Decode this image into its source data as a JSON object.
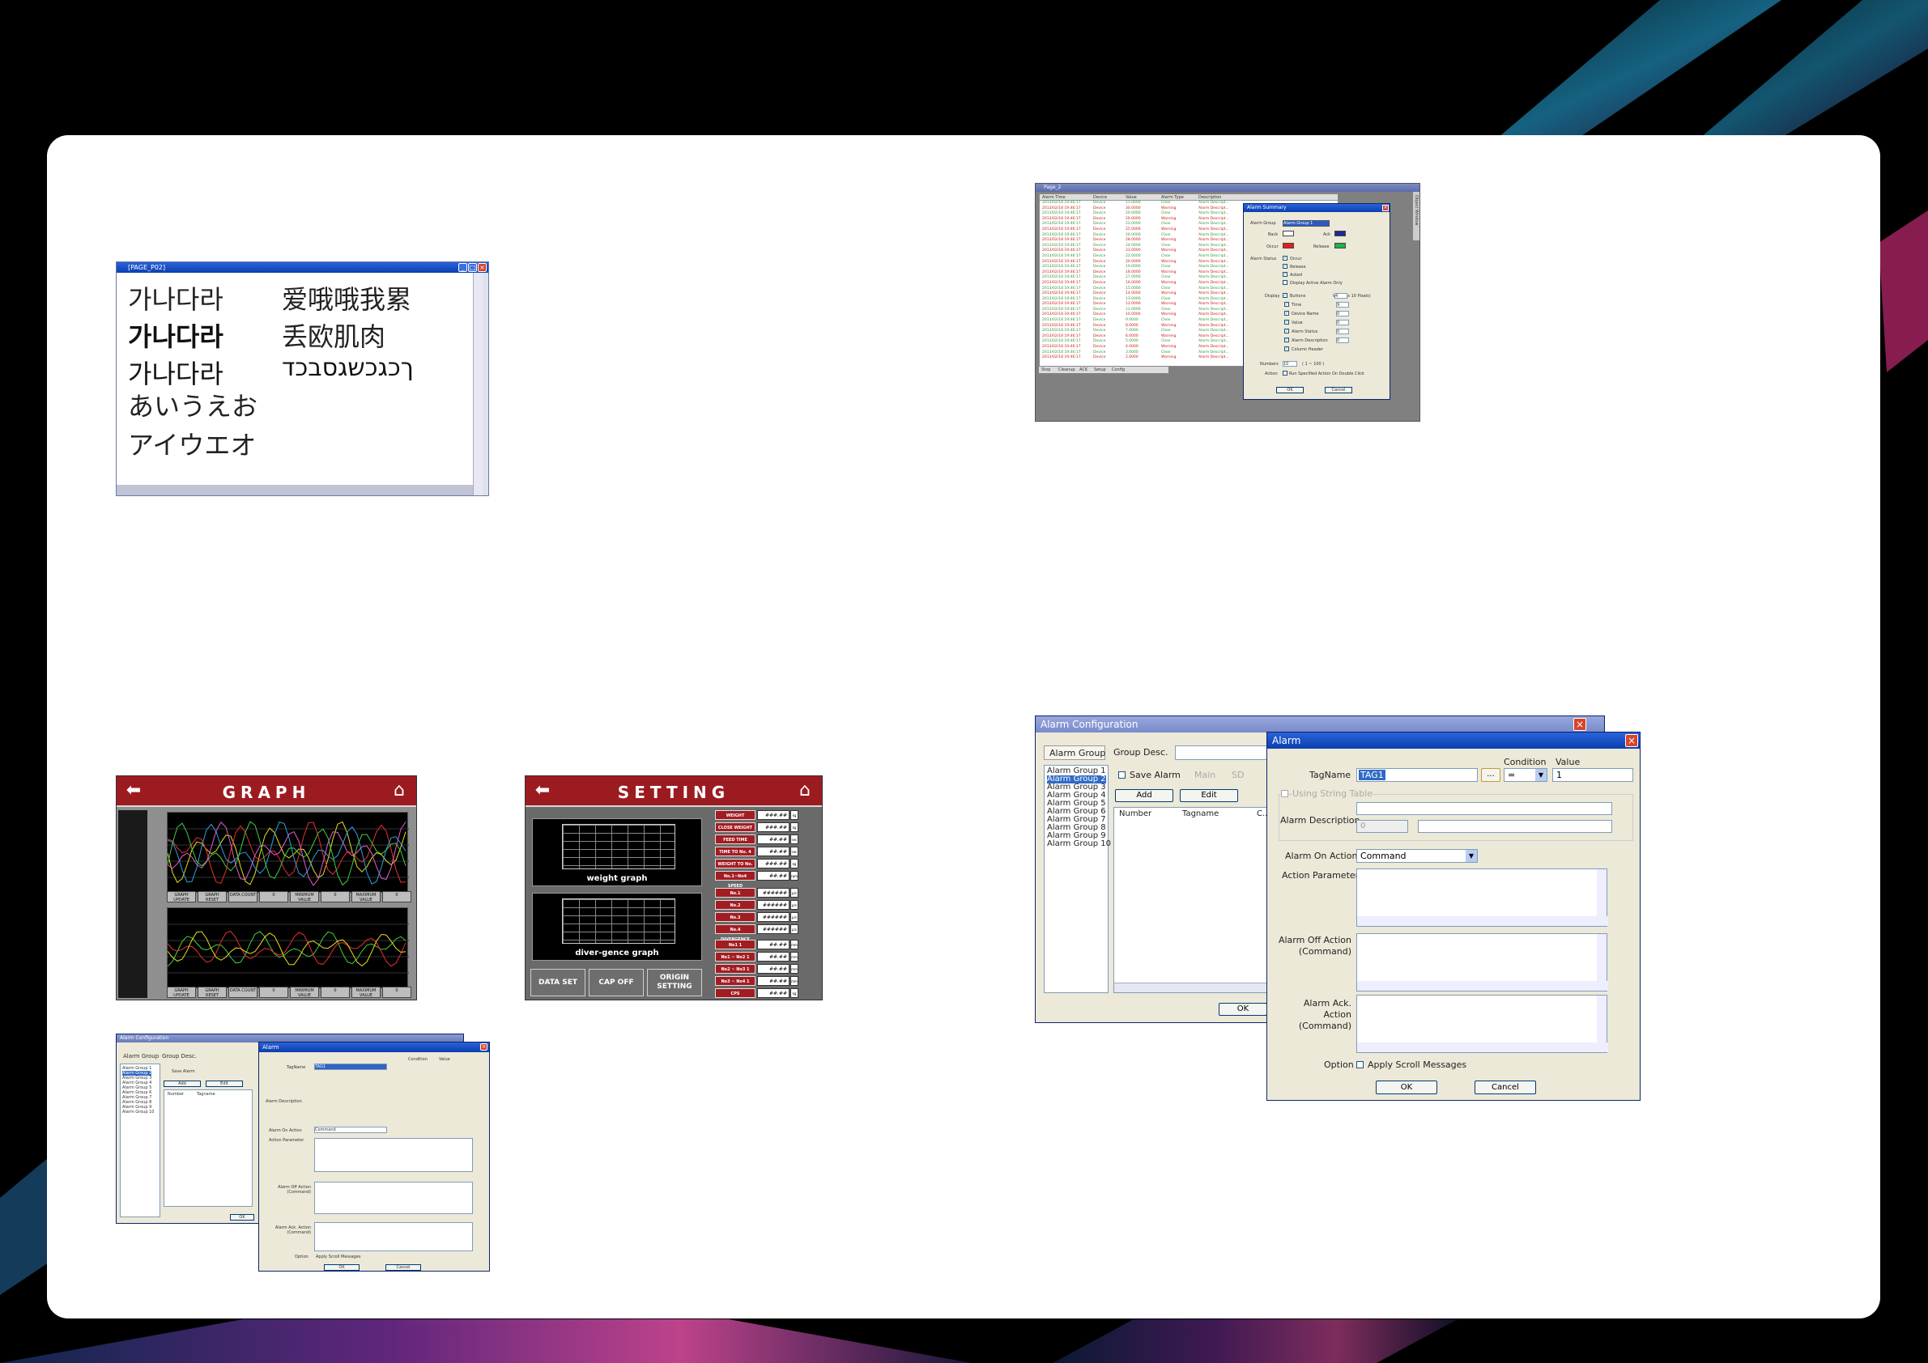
{
  "font_window": {
    "title": "[PAGE_P02]",
    "samples": {
      "korean_regular": "가나다라",
      "korean_bold": "가나다라",
      "korean_styled": "가나다라",
      "hiragana": "あいうえお",
      "katakana": "アイウエオ",
      "chinese_1": "爱哦哦我累",
      "chinese_2": "丢欧肌肉",
      "hebrew": "ךכגכשגסבכד"
    }
  },
  "alarm_summary_window": {
    "title": "Page_2",
    "columns": [
      "Alarm Time",
      "Device",
      "Value",
      "Alarm Type",
      "Description"
    ],
    "row_time": "2013/02/18 19:46:17",
    "row_device": "Device",
    "row_desc": "Alarm Descript...",
    "row_values": [
      "11.0000",
      "30.0000",
      "20.0000",
      "26.0000",
      "22.0000",
      "25.0000",
      "26.0000",
      "28.0000",
      "24.0000",
      "23.0000",
      "22.0000",
      "20.0000",
      "19.0000",
      "18.0000",
      "17.0000",
      "16.0000",
      "15.0000",
      "14.0000",
      "13.0000",
      "12.0000",
      "11.0000",
      "10.0000",
      "9.0000",
      "8.0000",
      "7.0000",
      "6.0000",
      "5.0000",
      "4.0000",
      "3.0000",
      "2.0000"
    ],
    "row_types": [
      "Clear",
      "Warning",
      "Clear",
      "Warning",
      "Clear",
      "Warning",
      "Clear",
      "Warning",
      "Clear",
      "Warning",
      "Clear",
      "Warning",
      "Clear",
      "Warning",
      "Clear",
      "Warning",
      "Clear",
      "Warning",
      "Clear",
      "Warning",
      "Clear",
      "Warning",
      "Clear",
      "Warning",
      "Clear",
      "Warning",
      "Clear",
      "Warning",
      "Clear",
      "Warning"
    ],
    "tabs": [
      "Stop",
      "Cleanup",
      "ACK",
      "Setup",
      "Config"
    ],
    "side_label": "Object Window",
    "colors": {
      "clear": "#2e9a3a",
      "warning": "#d01818"
    },
    "dialog": {
      "title": "Alarm Summary",
      "alarm_group_label": "Alarm Group",
      "alarm_group_value": "Alarm Group 1",
      "back": "Back",
      "ack": "Ack",
      "occur": "Occur",
      "release": "Release",
      "alarm_status": "Alarm Status",
      "status_opts": [
        "Occur",
        "Release",
        "Acked",
        "Display Active Alarm Only"
      ],
      "display": "Display",
      "width_label": "Width (x 10 Pixels)",
      "display_opts": [
        "Buttons",
        "Time",
        "Device Name",
        "Value",
        "Alarm Status",
        "Alarm Description",
        "Column Header"
      ],
      "width_vals": [
        "4",
        "9",
        "0",
        "0",
        "0",
        "0"
      ],
      "numbers": "Numbers",
      "numbers_val": "10",
      "numbers_range": "( 1 ~ 100 )",
      "action": "Action",
      "action_opt": "Run Specified Action On Double Click",
      "ok": "OK",
      "cancel": "Cancel"
    }
  },
  "graph_screen": {
    "title": "GRAPH",
    "buttons": [
      "GRAPH UPDATE",
      "GRAPH RESET",
      "DATA COUNT",
      "0",
      "MINIMUM VALUE",
      "0",
      "MAXIMUM VALUE",
      "0"
    ]
  },
  "setting_screen": {
    "title": "SETTING",
    "graph1_label": "weight graph",
    "graph2_label": "diver-gence graph",
    "rows": [
      {
        "label": "WEIGHT",
        "value": "###.##",
        "unit": "kg"
      },
      {
        "label": "CLOSE WEIGHT",
        "value": "###.##",
        "unit": "kg"
      },
      {
        "label": "FEED TIME",
        "value": "##.##",
        "unit": "sec"
      },
      {
        "label": "TIME TO No. 4",
        "value": "##.##",
        "unit": "sec"
      },
      {
        "label": "WEIGHT TO No. 4",
        "value": "###.##",
        "unit": "kg"
      },
      {
        "label": "No.1~No4 SPEED",
        "value": "##.##",
        "unit": "rpm"
      },
      {
        "label": "No.1 DIVERGENCE",
        "value": "######",
        "unit": "p/s"
      },
      {
        "label": "No.2 DIVERGENCE",
        "value": "######",
        "unit": "p/s"
      },
      {
        "label": "No.3 DIVERGENCE",
        "value": "######",
        "unit": "p/s"
      },
      {
        "label": "No.4 DIVERGENCE",
        "value": "######",
        "unit": "p/s"
      },
      {
        "label": "No1 1",
        "value": "##.##",
        "unit": "mm"
      },
      {
        "label": "No1 ~ No2 1",
        "value": "##.##",
        "unit": "mm"
      },
      {
        "label": "No2 ~ No3 1",
        "value": "##.##",
        "unit": "mm"
      },
      {
        "label": "No3 ~ No4 1",
        "value": "##.##",
        "unit": "mm"
      },
      {
        "label": "CPS",
        "value": "##.##",
        "unit": "kg"
      }
    ],
    "btn_data_set": "DATA SET",
    "btn_cap_off": "CAP OFF",
    "btn_origin": "ORIGIN SETTING"
  },
  "alarm_config": {
    "title": "Alarm Configuration",
    "tab_alarm_group": "Alarm Group",
    "tab_group_desc": "Group Desc.",
    "groups": [
      "Alarm Group 1",
      "Alarm Group 2",
      "Alarm Group 3",
      "Alarm Group 4",
      "Alarm Group 5",
      "Alarm Group 6",
      "Alarm Group 7",
      "Alarm Group 8",
      "Alarm Group 9",
      "Alarm Group 10"
    ],
    "save_alarm": "Save Alarm",
    "main": "Main",
    "sd": "SD",
    "add": "Add",
    "edit": "Edit",
    "col_number": "Number",
    "col_tagname": "Tagname",
    "col_c": "C...",
    "ok": "OK",
    "dialog": {
      "title": "Alarm",
      "tagname_label": "TagName",
      "tagname_value": "TAG1",
      "browse": "...",
      "condition_label": "Condition",
      "condition_value": "=",
      "value_label": "Value",
      "value_value": "1",
      "using_string": "Using String Table",
      "alarm_desc": "Alarm Description",
      "desc_num": "0",
      "on_action": "Alarm On Action",
      "on_action_value": "Command",
      "action_param": "Action Parameter",
      "off_action": "Alarm Off Action (Command)",
      "ack_action": "Alarm Ack. Action (Command)",
      "option": "Option",
      "apply_scroll": "Apply Scroll Messages",
      "ok": "OK",
      "cancel": "Cancel"
    }
  }
}
